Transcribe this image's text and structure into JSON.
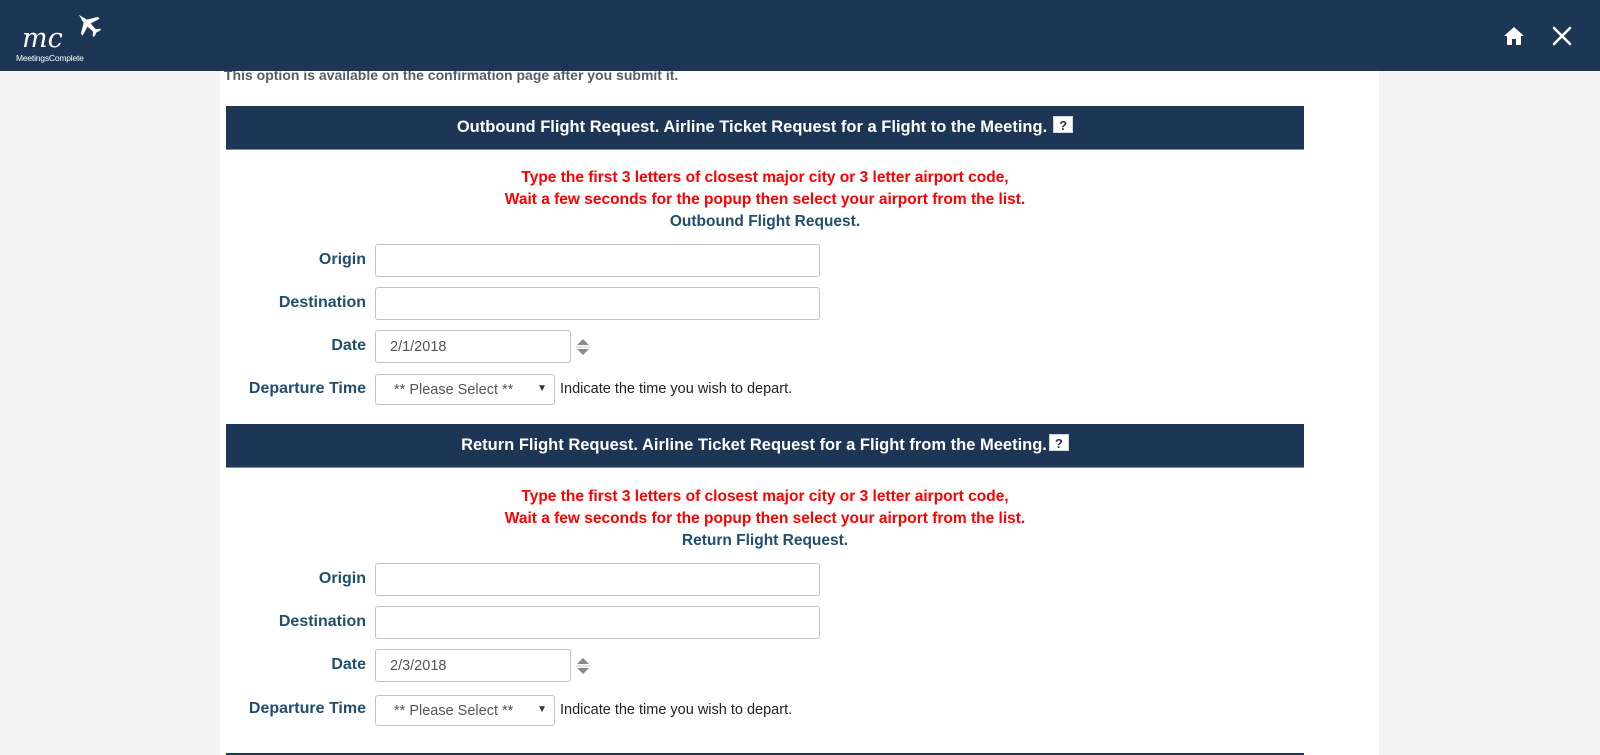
{
  "header": {
    "logo_text": "MeetingsComplete",
    "logo_mark": "mc",
    "home_icon": "home-icon",
    "close_icon": "close-icon",
    "background_color": "#1e3655"
  },
  "clipped_note": "This option is available on the confirmation page after you submit it.",
  "outbound": {
    "title": "Outbound Flight Request. Airline Ticket Request for a Flight to the Meeting.",
    "help": "?",
    "instruction_line1": "Type the first 3 letters of closest major city or 3 letter airport code,",
    "instruction_line2": "Wait a few seconds for the popup then select your airport from the list.",
    "subtitle": "Outbound Flight Request.",
    "origin_label": "Origin",
    "origin_value": "",
    "destination_label": "Destination",
    "destination_value": "",
    "date_label": "Date",
    "date_value": "2/1/2018",
    "departure_label": "Departure Time",
    "departure_selected": "** Please Select **",
    "departure_hint": "Indicate the time you wish to depart."
  },
  "return": {
    "title": "Return Flight Request. Airline Ticket Request for a Flight from the Meeting.",
    "help": "?",
    "instruction_line1": "Type the first 3 letters of closest major city or 3 letter airport code,",
    "instruction_line2": "Wait a few seconds for the popup then select your airport from the list.",
    "subtitle": "Return Flight Request.",
    "origin_label": "Origin",
    "origin_value": "",
    "destination_label": "Destination",
    "destination_value": "",
    "date_label": "Date",
    "date_value": "2/3/2018",
    "departure_label": "Departure Time",
    "departure_selected": "** Please Select **",
    "departure_hint": "Indicate the time you wish to depart."
  },
  "colors": {
    "navy": "#1e3655",
    "label_blue": "#1f4e6e",
    "warning_red": "#ff0000"
  }
}
